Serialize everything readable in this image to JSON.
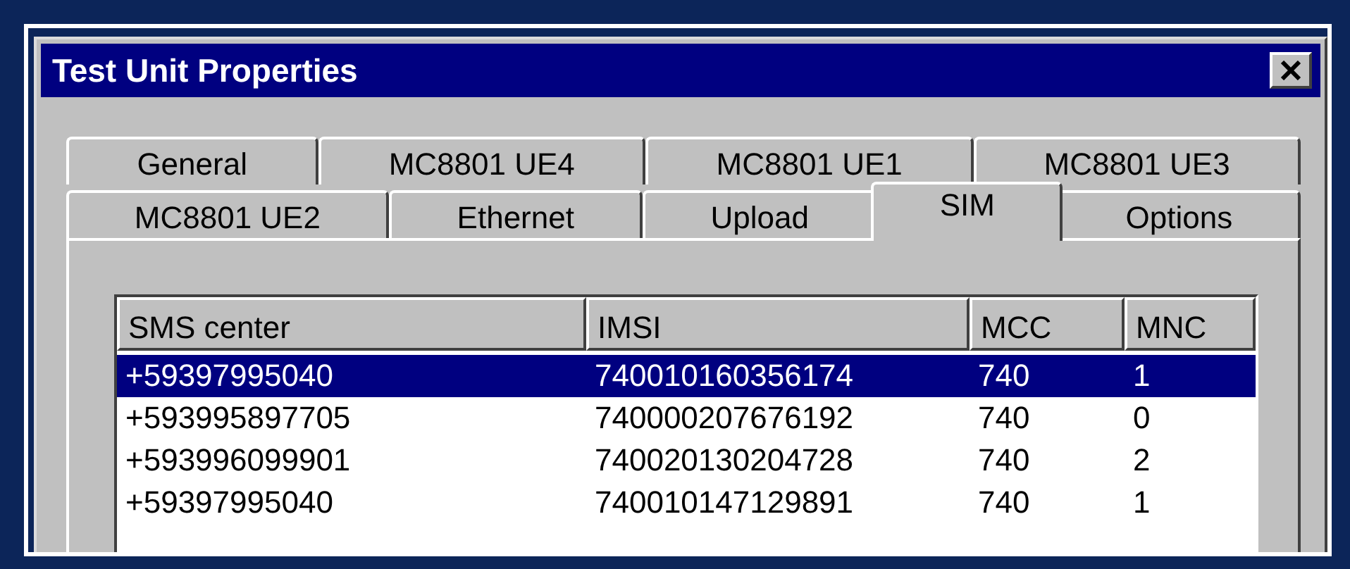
{
  "window": {
    "title": "Test Unit Properties"
  },
  "tab_rows": [
    {
      "tabs": [
        {
          "label": "General",
          "selected": false
        },
        {
          "label": "MC8801 UE4",
          "selected": false
        },
        {
          "label": "MC8801 UE1",
          "selected": false
        },
        {
          "label": "MC8801 UE3",
          "selected": false
        }
      ]
    },
    {
      "tabs": [
        {
          "label": "MC8801 UE2",
          "selected": false
        },
        {
          "label": "Ethernet",
          "selected": false
        },
        {
          "label": "Upload",
          "selected": false
        },
        {
          "label": "SIM",
          "selected": true
        },
        {
          "label": "Options",
          "selected": false
        }
      ]
    }
  ],
  "list": {
    "columns": [
      "SMS center",
      "IMSI",
      "MCC",
      "MNC"
    ],
    "rows": [
      {
        "cells": [
          "+59397995040",
          "740010160356174",
          "740",
          "1"
        ],
        "selected": true
      },
      {
        "cells": [
          "+593995897705",
          "740000207676192",
          "740",
          "0"
        ],
        "selected": false
      },
      {
        "cells": [
          "+593996099901",
          "740020130204728",
          "740",
          "2"
        ],
        "selected": false
      },
      {
        "cells": [
          "+59397995040",
          "740010147129891",
          "740",
          "1"
        ],
        "selected": false
      }
    ]
  }
}
